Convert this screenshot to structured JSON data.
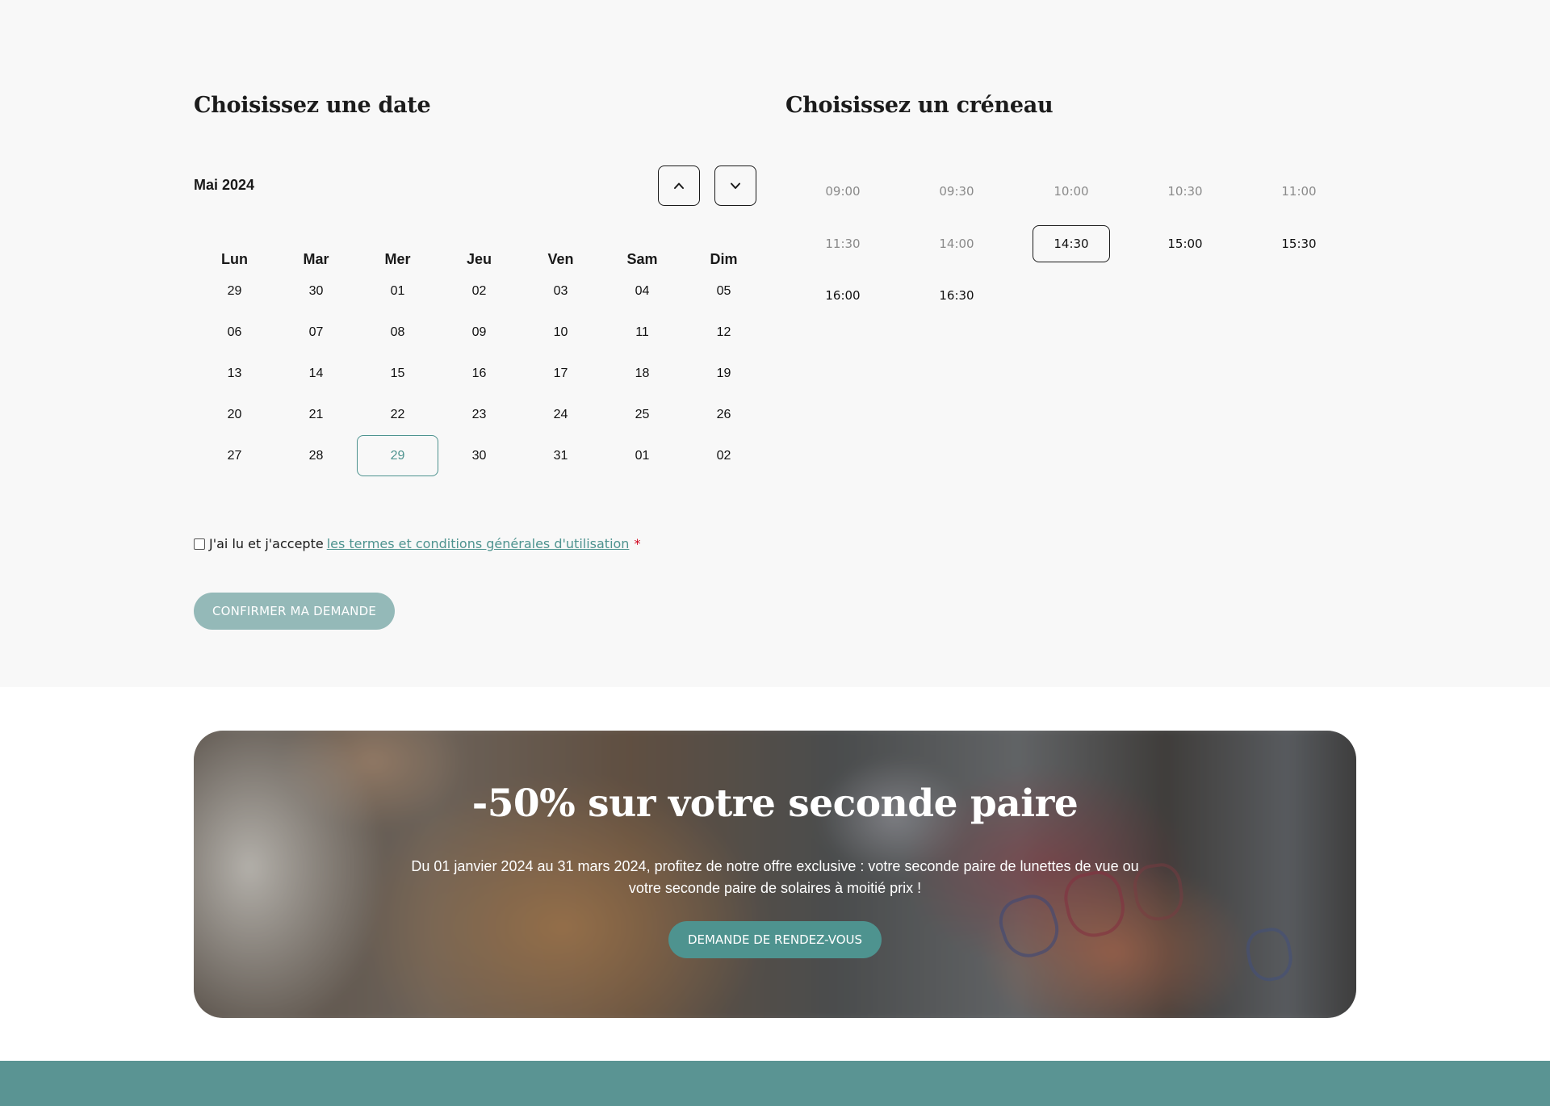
{
  "date_section": {
    "title": "Choisissez une date",
    "month_label": "Mai 2024",
    "prev_icon": "chevron-up-icon",
    "next_icon": "chevron-down-icon",
    "weekdays": [
      "Lun",
      "Mar",
      "Mer",
      "Jeu",
      "Ven",
      "Sam",
      "Dim"
    ],
    "weeks": [
      [
        "29",
        "30",
        "01",
        "02",
        "03",
        "04",
        "05"
      ],
      [
        "06",
        "07",
        "08",
        "09",
        "10",
        "11",
        "12"
      ],
      [
        "13",
        "14",
        "15",
        "16",
        "17",
        "18",
        "19"
      ],
      [
        "20",
        "21",
        "22",
        "23",
        "24",
        "25",
        "26"
      ],
      [
        "27",
        "28",
        "29",
        "30",
        "31",
        "01",
        "02"
      ]
    ],
    "selected_day": "29"
  },
  "slot_section": {
    "title": "Choisissez un créneau",
    "slots": [
      {
        "time": "09:00",
        "available": false
      },
      {
        "time": "09:30",
        "available": false
      },
      {
        "time": "10:00",
        "available": false
      },
      {
        "time": "10:30",
        "available": false
      },
      {
        "time": "11:00",
        "available": false
      },
      {
        "time": "11:30",
        "available": false
      },
      {
        "time": "14:00",
        "available": false
      },
      {
        "time": "14:30",
        "available": true,
        "selected": true
      },
      {
        "time": "15:00",
        "available": true
      },
      {
        "time": "15:30",
        "available": true
      },
      {
        "time": "16:00",
        "available": true
      },
      {
        "time": "16:30",
        "available": true
      }
    ]
  },
  "terms": {
    "text": "J'ai lu et j'accepte",
    "link": "les termes et conditions générales d'utilisation",
    "required": "*"
  },
  "confirm_button": "CONFIRMER MA DEMANDE",
  "promo": {
    "title": "-50% sur votre seconde paire",
    "text": "Du 01 janvier 2024 au 31 mars 2024, profitez de notre offre exclusive : votre seconde paire de lunettes de vue ou votre seconde paire de solaires à moitié prix !",
    "cta": "DEMANDE DE RENDEZ-VOUS"
  },
  "colors": {
    "accent": "#4e938f",
    "confirm_button": "#94b9b8",
    "footer": "#5a9493",
    "required": "#d0021b"
  }
}
